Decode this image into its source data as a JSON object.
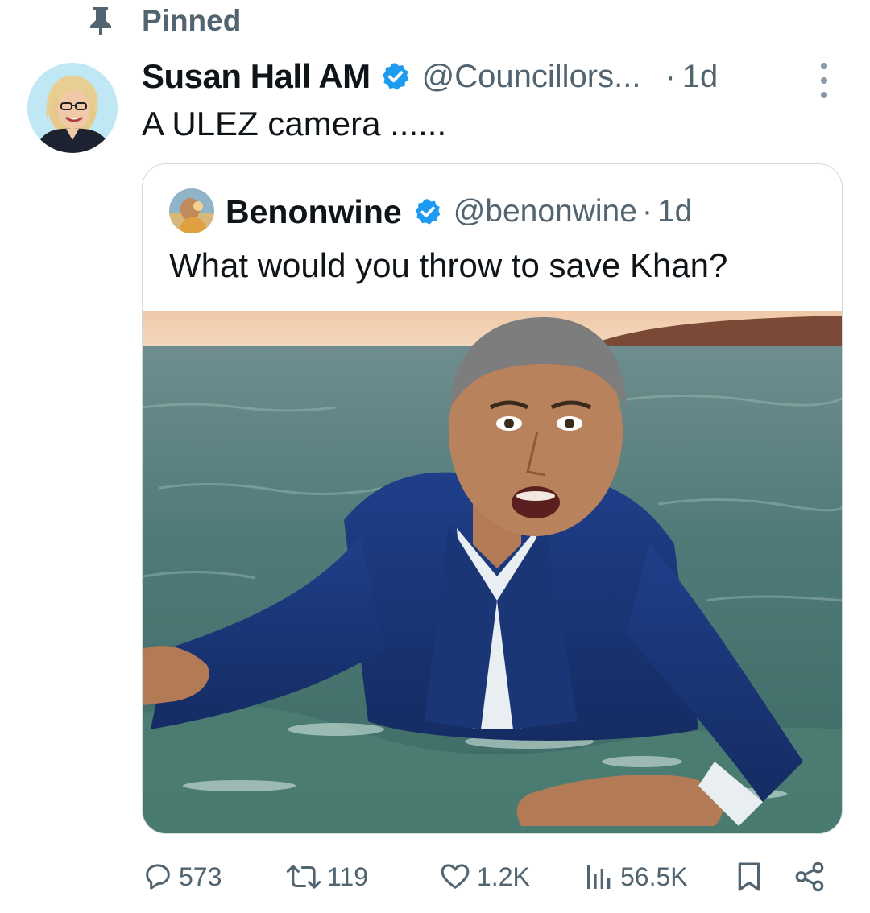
{
  "pinned": {
    "label": "Pinned",
    "icon": "pin-icon"
  },
  "tweet": {
    "author_name": "Susan Hall AM",
    "handle": "@Councillors...",
    "separator": "·",
    "time": "1d",
    "text": "A ULEZ camera ......",
    "verified": true,
    "icons": [
      "verified-badge-icon",
      "more-options-icon"
    ]
  },
  "quote": {
    "author_name": "Benonwine",
    "handle": "@benonwine",
    "separator": "·",
    "time": "1d",
    "text": "What would you throw to save Khan?",
    "verified": true,
    "media_icon": "photo-man-in-sea"
  },
  "actions": {
    "reply": {
      "icon": "reply-icon",
      "count": "573"
    },
    "retweet": {
      "icon": "retweet-icon",
      "count": "119"
    },
    "like": {
      "icon": "heart-icon",
      "count": "1.2K"
    },
    "views": {
      "icon": "analytics-icon",
      "count": "56.5K"
    },
    "bookmark": {
      "icon": "bookmark-icon"
    },
    "share": {
      "icon": "share-icon"
    }
  },
  "colors": {
    "text_primary": "#0f1419",
    "text_secondary": "#536471",
    "verified_blue": "#1d9bf0",
    "border": "#cfd9de"
  }
}
